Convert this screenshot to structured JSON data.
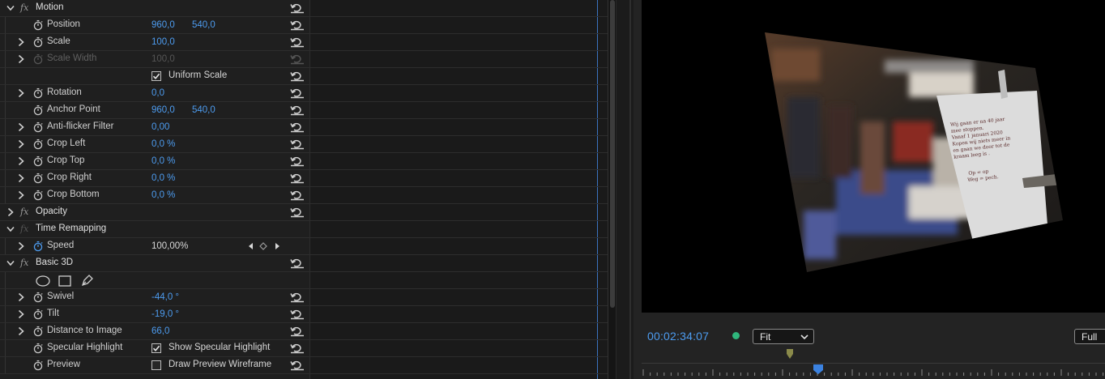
{
  "effect_controls": {
    "rows": [
      {
        "type": "section",
        "name": "Motion",
        "expanded": true,
        "fx": true
      },
      {
        "type": "prop",
        "name": "Position",
        "value1": "960,0",
        "value2": "540,0",
        "twirl": false
      },
      {
        "type": "prop",
        "name": "Scale",
        "value1": "100,0",
        "twirl": true
      },
      {
        "type": "prop",
        "name": "Scale Width",
        "value1": "100,0",
        "twirl": true,
        "disabled": true
      },
      {
        "type": "checkbox",
        "label": "Uniform Scale",
        "checked": true
      },
      {
        "type": "prop",
        "name": "Rotation",
        "value1": "0,0",
        "twirl": true
      },
      {
        "type": "prop",
        "name": "Anchor Point",
        "value1": "960,0",
        "value2": "540,0",
        "twirl": false
      },
      {
        "type": "prop",
        "name": "Anti-flicker Filter",
        "value1": "0,00",
        "twirl": true
      },
      {
        "type": "prop",
        "name": "Crop Left",
        "value1": "0,0 %",
        "twirl": true
      },
      {
        "type": "prop",
        "name": "Crop Top",
        "value1": "0,0 %",
        "twirl": true
      },
      {
        "type": "prop",
        "name": "Crop Right",
        "value1": "0,0 %",
        "twirl": true
      },
      {
        "type": "prop",
        "name": "Crop Bottom",
        "value1": "0,0 %",
        "twirl": true
      },
      {
        "type": "section",
        "name": "Opacity",
        "expanded": false,
        "fx": true
      },
      {
        "type": "section",
        "name": "Time Remapping",
        "expanded": true,
        "fx": true,
        "fx_dim": true,
        "no_reset": true
      },
      {
        "type": "speed",
        "name": "Speed",
        "value1": "100,00%",
        "twirl": true
      },
      {
        "type": "section",
        "name": "Basic 3D",
        "expanded": true,
        "fx": true
      },
      {
        "type": "masks"
      },
      {
        "type": "prop",
        "name": "Swivel",
        "value1": "-44,0 °",
        "twirl": true
      },
      {
        "type": "prop",
        "name": "Tilt",
        "value1": "-19,0 °",
        "twirl": true
      },
      {
        "type": "prop",
        "name": "Distance to Image",
        "value1": "66,0",
        "twirl": true
      },
      {
        "type": "checkprop",
        "name": "Specular Highlight",
        "label": "Show Specular Highlight",
        "checked": true
      },
      {
        "type": "checkprop",
        "name": "Preview",
        "label": "Draw Preview Wireframe",
        "checked": false
      }
    ]
  },
  "monitor": {
    "timecode": "00:02:34:07",
    "zoom_select": "Fit",
    "resolution_select": "Full",
    "status_color": "#2fb67c",
    "accent_color": "#4d9cf0",
    "sign_text": [
      "Wij gaan er na 40 jaar",
      "mee stoppen.",
      "Vanaf 1 januari 2020",
      "Kopen wij niets meer in",
      "en gaan we door tot de",
      "kraam leeg is .",
      "",
      "Op = op",
      "Weg = pech."
    ]
  }
}
